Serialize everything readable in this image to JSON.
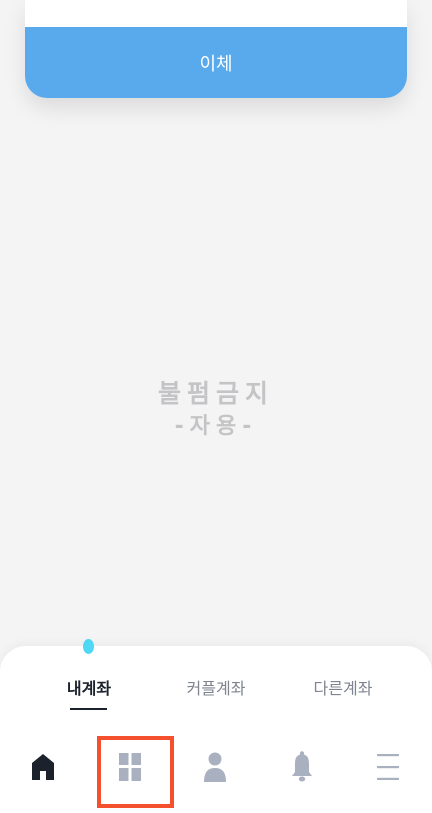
{
  "card": {
    "button_label": "이체"
  },
  "watermark": {
    "line1": "불펌금지",
    "line2": "-자용-"
  },
  "tabs": [
    {
      "label": "내계좌",
      "active": true
    },
    {
      "label": "커플계좌",
      "active": false
    },
    {
      "label": "다른계좌",
      "active": false
    }
  ],
  "bottom_nav": [
    {
      "icon": "home-icon",
      "active": true
    },
    {
      "icon": "grid-icon",
      "active": false,
      "highlighted": true
    },
    {
      "icon": "person-icon",
      "active": false
    },
    {
      "icon": "bell-icon",
      "active": false
    },
    {
      "icon": "menu-icon",
      "active": false
    }
  ],
  "colors": {
    "primary_button": "#59aaed",
    "active_text": "#1c222c",
    "inactive_icon": "#a9b0bf",
    "highlight_box": "#f4502e",
    "indicator_dot": "#4fd8f5"
  }
}
